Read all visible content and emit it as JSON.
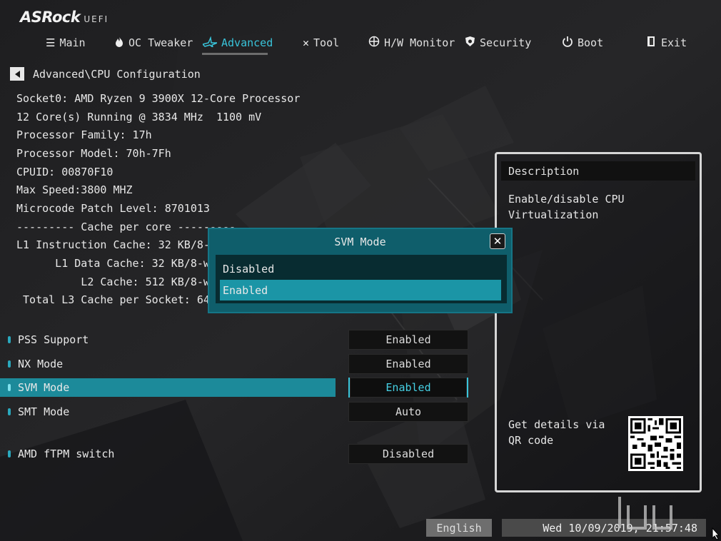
{
  "brand": {
    "name": "ASRock",
    "sub": "UEFI"
  },
  "tabs": [
    {
      "label": "Main",
      "icon": "list-icon",
      "active": false
    },
    {
      "label": "OC Tweaker",
      "icon": "flame-icon",
      "active": false
    },
    {
      "label": "Advanced",
      "icon": "star-icon",
      "active": true
    },
    {
      "label": "Tool",
      "icon": "tools-icon",
      "active": false
    },
    {
      "label": "H/W Monitor",
      "icon": "crosshair-icon",
      "active": false
    },
    {
      "label": "Security",
      "icon": "shield-icon",
      "active": false
    },
    {
      "label": "Boot",
      "icon": "power-icon",
      "active": false
    },
    {
      "label": "Exit",
      "icon": "exit-icon",
      "active": false
    }
  ],
  "breadcrumb": "Advanced\\CPU Configuration",
  "info": [
    "Socket0: AMD Ryzen 9 3900X 12-Core Processor",
    "12 Core(s) Running @ 3834 MHz  1100 mV",
    "Processor Family: 17h",
    "Processor Model: 70h-7Fh",
    "CPUID: 00870F10",
    "Max Speed:3800 MHZ",
    "Microcode Patch Level: 8701013",
    "--------- Cache per core ---------",
    "L1 Instruction Cache: 32 KB/8-way",
    "      L1 Data Cache: 32 KB/8-way",
    "          L2 Cache: 512 KB/8-way",
    " Total L3 Cache per Socket: 64 MB"
  ],
  "settings": [
    {
      "label": "PSS Support",
      "value": "Enabled",
      "selected": false
    },
    {
      "label": "NX Mode",
      "value": "Enabled",
      "selected": false
    },
    {
      "label": "SVM Mode",
      "value": "Enabled",
      "selected": true
    },
    {
      "label": "SMT Mode",
      "value": "Auto",
      "selected": false
    },
    {
      "label": "AMD fTPM switch",
      "value": "Disabled",
      "selected": false
    }
  ],
  "description": {
    "title": "Description",
    "text": "Enable/disable CPU Virtualization",
    "qr_text": "Get details via QR code"
  },
  "popup": {
    "title": "SVM Mode",
    "close_icon": "close-icon",
    "options": [
      {
        "label": "Disabled",
        "selected": false
      },
      {
        "label": "Enabled",
        "selected": true
      }
    ]
  },
  "footer": {
    "language": "English",
    "datetime": "Wed 10/09/2019, 21:57:48"
  },
  "colors": {
    "accent": "#39c4da",
    "selected_row": "#1c8a9a",
    "popup_bg": "#0f5e6b",
    "popup_sel": "#1b95a6"
  }
}
